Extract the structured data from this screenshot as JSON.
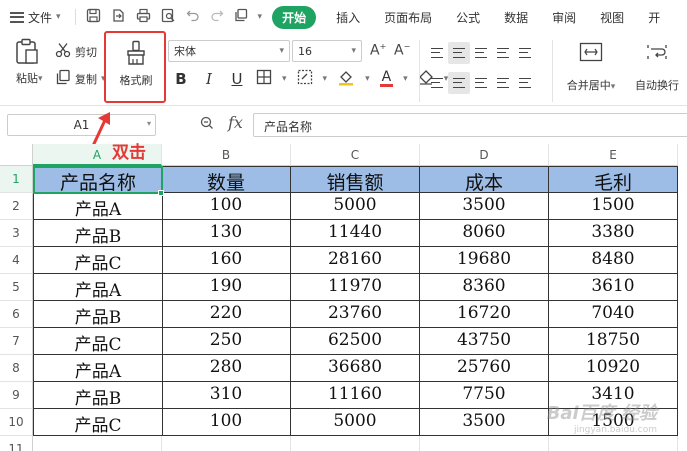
{
  "menubar": {
    "file_label": "文件",
    "start_tab": "开始",
    "tabs": [
      "插入",
      "页面布局",
      "公式",
      "数据",
      "审阅",
      "视图",
      "开"
    ]
  },
  "ribbon": {
    "paste_label": "粘贴",
    "cut_label": "剪切",
    "copy_label": "复制",
    "format_painter_label": "格式刷",
    "font_name": "宋体",
    "font_size": "16",
    "merge_label": "合并居中",
    "wrap_label": "自动换行",
    "bold": "B",
    "italic": "I",
    "underline": "U"
  },
  "formula_bar": {
    "name_box": "A1",
    "fx": "fx",
    "content": "产品名称"
  },
  "annotation": {
    "text": "双击",
    "color": "#e53935"
  },
  "sheet": {
    "columns": [
      "A",
      "B",
      "C",
      "D",
      "E"
    ],
    "rows": [
      "1",
      "2",
      "3",
      "4",
      "5",
      "6",
      "7",
      "8",
      "9",
      "10",
      "11"
    ],
    "header": [
      "产品名称",
      "数量",
      "销售额",
      "成本",
      "毛利"
    ],
    "data": [
      [
        "产品A",
        "100",
        "5000",
        "3500",
        "1500"
      ],
      [
        "产品B",
        "130",
        "11440",
        "8060",
        "3380"
      ],
      [
        "产品C",
        "160",
        "28160",
        "19680",
        "8480"
      ],
      [
        "产品A",
        "190",
        "11970",
        "8360",
        "3610"
      ],
      [
        "产品B",
        "220",
        "23760",
        "16720",
        "7040"
      ],
      [
        "产品C",
        "250",
        "62500",
        "43750",
        "18750"
      ],
      [
        "产品A",
        "280",
        "36680",
        "25760",
        "10920"
      ],
      [
        "产品B",
        "310",
        "11160",
        "7750",
        "3410"
      ],
      [
        "产品C",
        "100",
        "5000",
        "3500",
        "1500"
      ]
    ],
    "header_fill": "#9dbde6",
    "selection_color": "#1fa363"
  },
  "watermark": {
    "text": "Bai百度 经验",
    "sub": "jingyan.baidu.com"
  }
}
